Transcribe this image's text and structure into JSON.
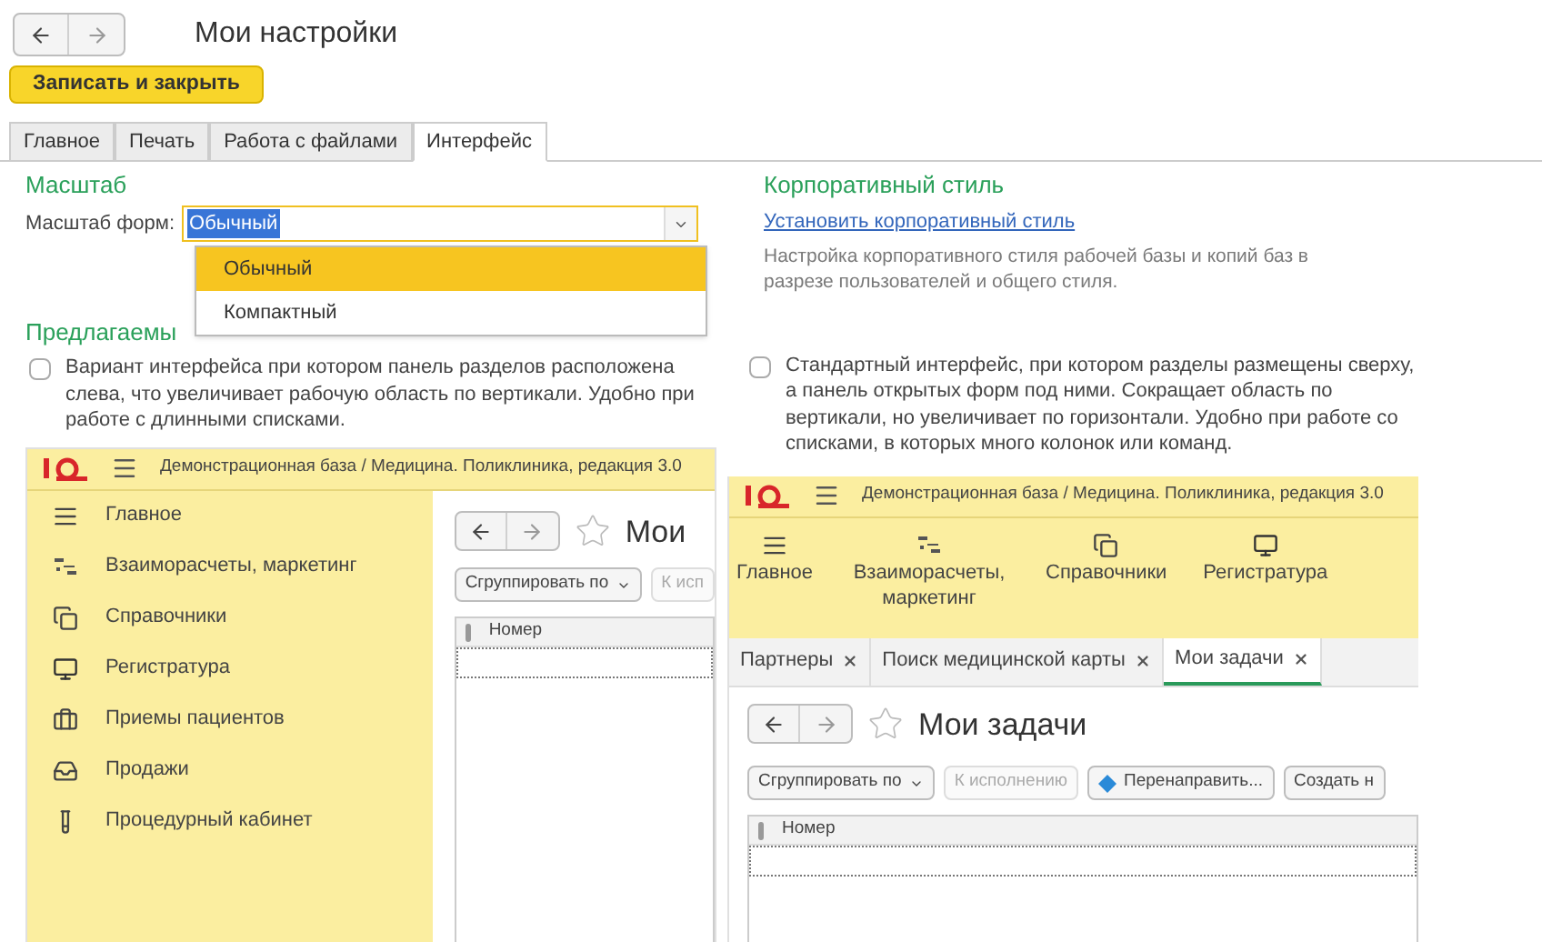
{
  "title": "Мои настройки",
  "save_button": "Записать и закрыть",
  "tabs": [
    {
      "label": "Главное",
      "selected": false
    },
    {
      "label": "Печать",
      "selected": false
    },
    {
      "label": "Работа с файлами",
      "selected": false
    },
    {
      "label": "Интерфейс",
      "selected": true
    }
  ],
  "scale": {
    "heading": "Масштаб",
    "label": "Масштаб форм:",
    "value": "Обычный",
    "options": [
      {
        "label": "Обычный",
        "selected": true
      },
      {
        "label": "Компактный",
        "selected": false
      }
    ]
  },
  "corporate": {
    "heading": "Корпоративный стиль",
    "link": "Установить корпоративный стиль",
    "description": "Настройка корпоративного стиля рабочей базы и копий баз в разрезе пользователей и общего стиля."
  },
  "suggested": {
    "heading": "Предлагаемы"
  },
  "variants": [
    {
      "kind": "sidebar",
      "checked": false,
      "description": "Вариант интерфейса при котором панель разделов расположена слева, что увеличивает рабочую область по вертикали. Удобно при работе с длинными списками.",
      "preview": {
        "app_title": "Демонстрационная база / Медицина. Поликлиника, редакция 3.0",
        "sections": [
          "Главное",
          "Взаиморасчеты, маркетинг",
          "Справочники",
          "Регистратура",
          "Приемы пациентов",
          "Продажи",
          "Процедурный кабинет"
        ],
        "page_title": "Мои",
        "buttons": [
          {
            "label": "Сгруппировать по",
            "kind": "menu",
            "disabled": false
          },
          {
            "label": "К исп",
            "kind": "plain",
            "disabled": true
          }
        ],
        "column": "Номер"
      }
    },
    {
      "kind": "topbar",
      "checked": false,
      "description": "Стандартный интерфейс, при котором разделы размещены сверху, а панель открытых форм под ними. Сокращает область по вертикали, но увеличивает по горизонтали. Удобно при работе со списками, в которых много колонок или команд.",
      "preview": {
        "app_title": "Демонстрационная база / Медицина. Поликлиника, редакция 3.0",
        "sections": [
          "Главное",
          "Взаиморасчеты, маркетинг",
          "Справочники",
          "Регистратура"
        ],
        "open_tabs": [
          {
            "label": "Партнеры",
            "selected": false
          },
          {
            "label": "Поиск медицинской карты",
            "selected": false
          },
          {
            "label": "Мои задачи",
            "selected": true
          }
        ],
        "page_title": "Мои задачи",
        "buttons": [
          {
            "label": "Сгруппировать по",
            "kind": "menu",
            "disabled": false
          },
          {
            "label": "К исполнению",
            "kind": "plain",
            "disabled": true
          },
          {
            "label": "Перенаправить...",
            "kind": "icon",
            "disabled": false
          },
          {
            "label": "Создать н",
            "kind": "plain",
            "disabled": false
          }
        ],
        "column": "Номер"
      }
    }
  ]
}
